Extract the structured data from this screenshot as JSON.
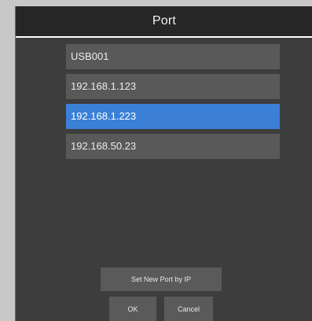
{
  "window": {
    "title": "Port"
  },
  "ports": [
    {
      "label": "USB001",
      "selected": false
    },
    {
      "label": "192.168.1.123",
      "selected": false
    },
    {
      "label": "192.168.1.223",
      "selected": true
    },
    {
      "label": "192.168.50.23",
      "selected": false
    }
  ],
  "buttons": {
    "set_new_port_label": "Set New Port by IP",
    "ok_label": "OK",
    "cancel_label": "Cancel"
  },
  "colors": {
    "selection": "#3b80d6",
    "title_bar": "#262626",
    "window_background": "#3d3d3d",
    "item_background": "#595959"
  }
}
